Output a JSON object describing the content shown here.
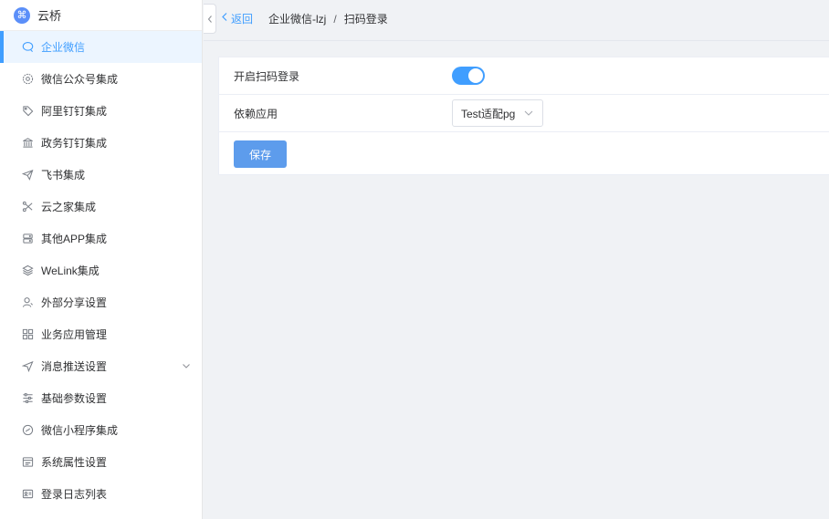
{
  "app": {
    "name": "云桥",
    "logo_glyph": "⌘"
  },
  "sidebar": {
    "items": [
      {
        "label": "企业微信",
        "icon": "chat-icon",
        "active": true
      },
      {
        "label": "微信公众号集成",
        "icon": "gear-badge-icon"
      },
      {
        "label": "阿里钉钉集成",
        "icon": "tag-icon"
      },
      {
        "label": "政务钉钉集成",
        "icon": "bank-icon"
      },
      {
        "label": "飞书集成",
        "icon": "paper-plane-icon"
      },
      {
        "label": "云之家集成",
        "icon": "scissors-icon"
      },
      {
        "label": "其他APP集成",
        "icon": "server-icon"
      },
      {
        "label": "WeLink集成",
        "icon": "layers-icon"
      },
      {
        "label": "外部分享设置",
        "icon": "user-icon"
      },
      {
        "label": "业务应用管理",
        "icon": "grid-icon"
      },
      {
        "label": "消息推送设置",
        "icon": "send-icon",
        "expandable": true
      },
      {
        "label": "基础参数设置",
        "icon": "sliders-icon"
      },
      {
        "label": "微信小程序集成",
        "icon": "mini-program-icon"
      },
      {
        "label": "系统属性设置",
        "icon": "window-icon"
      },
      {
        "label": "登录日志列表",
        "icon": "id-card-icon"
      }
    ]
  },
  "header": {
    "back_label": "返回",
    "breadcrumb_parent": "企业微信-lzj",
    "breadcrumb_separator": "/",
    "breadcrumb_current": "扫码登录"
  },
  "form": {
    "scan_login_label": "开启扫码登录",
    "scan_login_enabled": true,
    "dependent_app_label": "依赖应用",
    "dependent_app_value": "Test适配pg",
    "save_label": "保存"
  },
  "colors": {
    "accent": "#409eff",
    "save_button": "#5d9cec",
    "background": "#f0f2f5"
  }
}
